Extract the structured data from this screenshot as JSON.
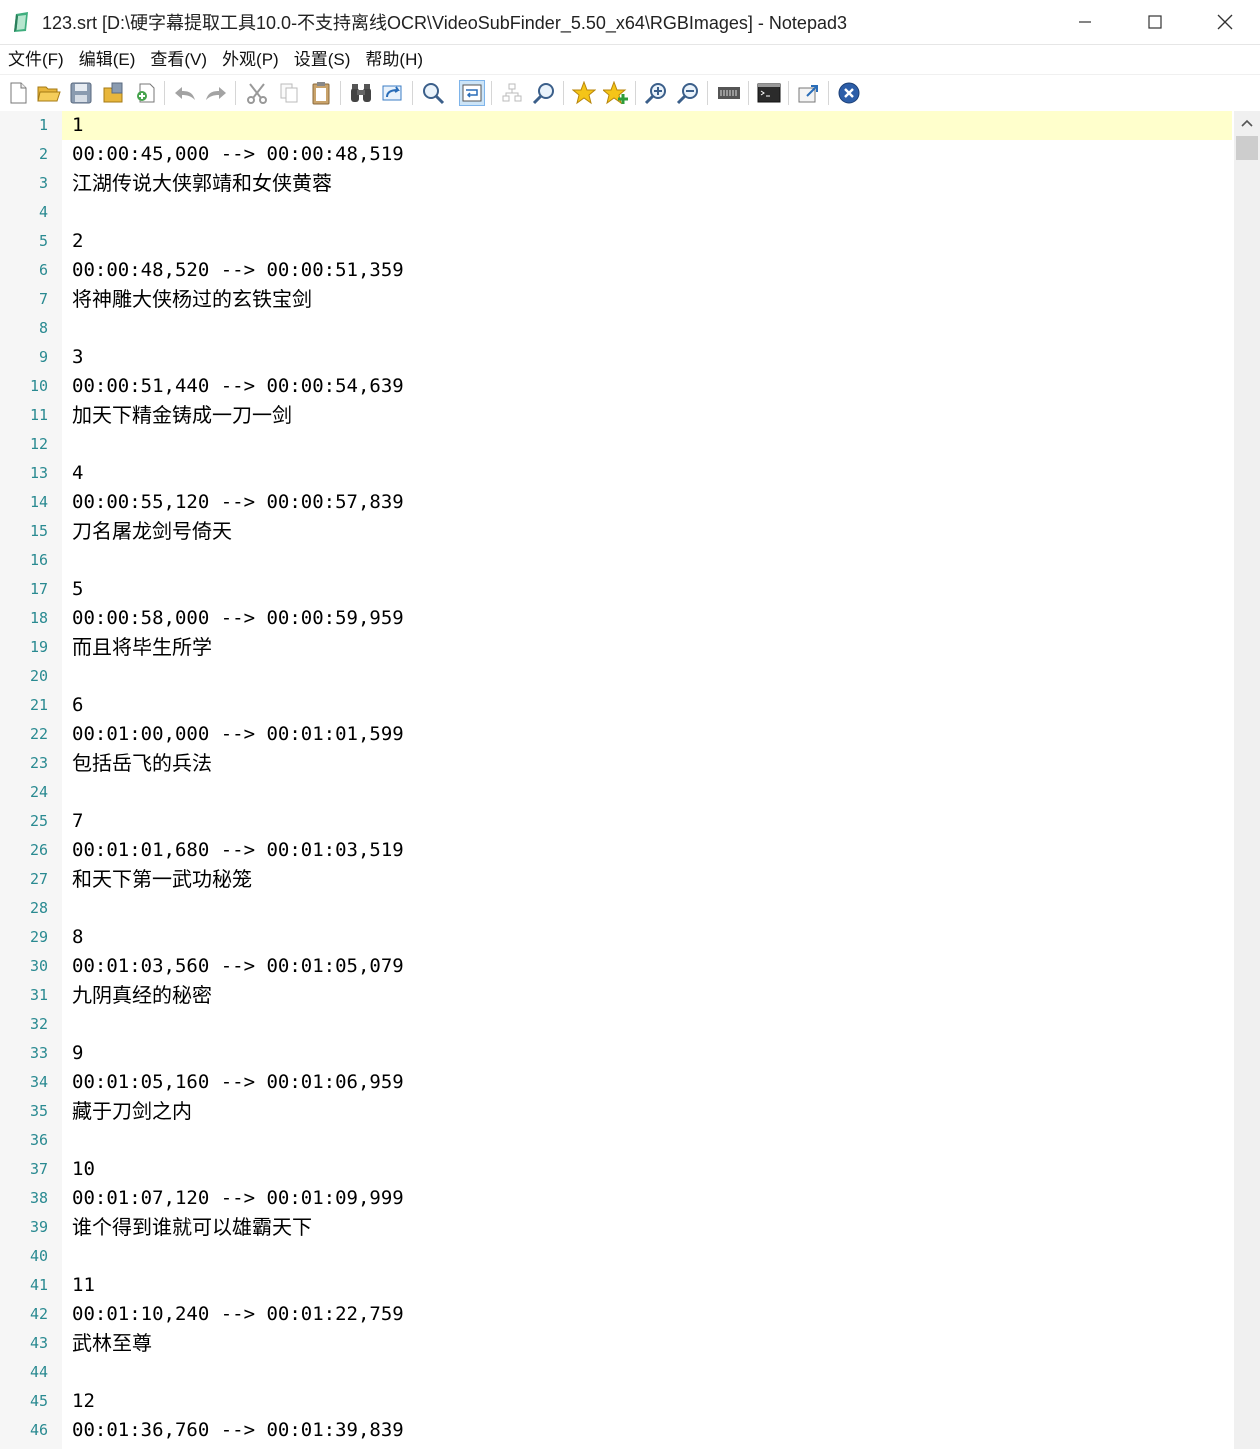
{
  "window": {
    "title": "123.srt [D:\\硬字幕提取工具10.0-不支持离线OCR\\VideoSubFinder_5.50_x64\\RGBImages] - Notepad3",
    "app_icon": "notepad3-icon",
    "controls": [
      "minimize-icon",
      "maximize-icon",
      "close-icon"
    ]
  },
  "menu": {
    "file": "文件(F)",
    "edit": "编辑(E)",
    "view": "查看(V)",
    "appearance": "外观(P)",
    "settings": "设置(S)",
    "help": "帮助(H)"
  },
  "toolbar": {
    "icons": [
      "new-file-icon",
      "open-folder-icon",
      "save-icon",
      "save-as-icon",
      "browse-icon",
      "undo-icon",
      "redo-icon",
      "cut-icon",
      "copy-icon",
      "paste-icon",
      "find-icon",
      "replace-icon",
      "goto-icon",
      "word-wrap-icon",
      "toggle-folds-icon",
      "search-next-icon",
      "bookmark-icon",
      "add-bookmark-icon",
      "zoom-in-icon",
      "zoom-out-icon",
      "schema-icon",
      "terminal-icon",
      "favorites-icon",
      "exit-icon"
    ],
    "active": "word-wrap-icon"
  },
  "editor": {
    "current_line": 1,
    "lines": [
      "1",
      "00:00:45,000 --> 00:00:48,519",
      "江湖传说大侠郭靖和女侠黄蓉",
      "",
      "2",
      "00:00:48,520 --> 00:00:51,359",
      "将神雕大侠杨过的玄铁宝剑",
      "",
      "3",
      "00:00:51,440 --> 00:00:54,639",
      "加天下精金铸成一刀一剑",
      "",
      "4",
      "00:00:55,120 --> 00:00:57,839",
      "刀名屠龙剑号倚天",
      "",
      "5",
      "00:00:58,000 --> 00:00:59,959",
      "而且将毕生所学",
      "",
      "6",
      "00:01:00,000 --> 00:01:01,599",
      "包括岳飞的兵法",
      "",
      "7",
      "00:01:01,680 --> 00:01:03,519",
      "和天下第一武功秘笼",
      "",
      "8",
      "00:01:03,560 --> 00:01:05,079",
      "九阴真经的秘密",
      "",
      "9",
      "00:01:05,160 --> 00:01:06,959",
      "藏于刀剑之内",
      "",
      "10",
      "00:01:07,120 --> 00:01:09,999",
      "谁个得到谁就可以雄霸天下",
      "",
      "11",
      "00:01:10,240 --> 00:01:22,759",
      "武林至尊",
      "",
      "12",
      "00:01:36,760 --> 00:01:39,839"
    ]
  },
  "colors": {
    "current_line_bg": "#ffffcc",
    "line_number": "#2a8a91",
    "gutter_bg": "#f6f6f6"
  }
}
